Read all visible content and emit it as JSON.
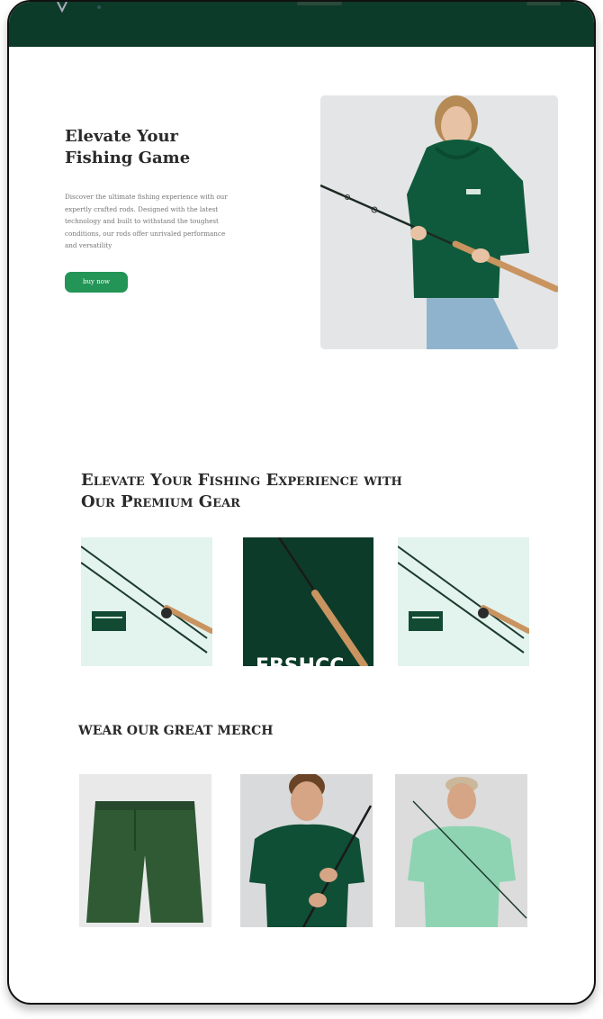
{
  "hero": {
    "title": "Elevate Your Fishing Game",
    "description": "Discover the ultimate fishing experience with our expertly crafted rods. Designed with the latest technology and built to withstand the toughest conditions, our rods offer unrivaled performance and versatility",
    "cta_label": "buy now"
  },
  "gear": {
    "title": "Elevate Your Fishing Experience with Our Premium Gear",
    "product2_text": "FBSHCC"
  },
  "merch": {
    "title": "WEAR OUR GREAT MERCH"
  },
  "colors": {
    "brand_dark": "#0d3b2a",
    "accent_button": "#239556",
    "mint": "#e3f3ee"
  }
}
